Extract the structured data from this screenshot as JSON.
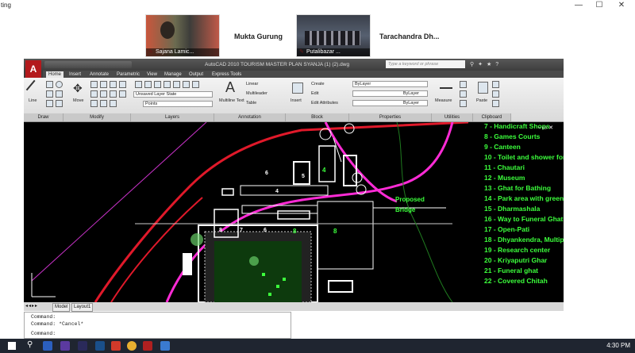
{
  "window": {
    "title": "ting",
    "buttons": [
      "—",
      "☐",
      "✕"
    ]
  },
  "participants": [
    {
      "caption": "Sajana Lamic...",
      "name": ""
    },
    {
      "caption": "",
      "name": "Mukta Gurung"
    },
    {
      "caption": "Putalibazar ...",
      "name": ""
    },
    {
      "caption": "",
      "name": "Tarachandra  Dh..."
    }
  ],
  "acad": {
    "title": "AutoCAD 2010    TOURISM MASTER PLAN SYANJA (1) (2).dwg",
    "search_placeholder": "Type a keyword or phrase",
    "tabs": [
      "Home",
      "Insert",
      "Annotate",
      "Parametric",
      "View",
      "Manage",
      "Output",
      "Express Tools"
    ],
    "panels": [
      "Draw",
      "Modify",
      "Layers",
      "Annotation",
      "Block",
      "Properties",
      "Utilities",
      "Clipboard"
    ],
    "ribbon": {
      "line": "Line",
      "move": "Move",
      "layer_state": "Unsaved Layer State",
      "points": "Points",
      "multiline_text": "Multiline Text",
      "linear": "Linear",
      "multileader": "Multileader",
      "table": "Table",
      "insert": "Insert",
      "create": "Create",
      "edit": "Edit",
      "edit_attributes": "Edit Attributes",
      "bylayer": "ByLayer",
      "measure": "Measure",
      "paste": "Paste"
    },
    "layout_tabs": [
      "Model",
      "Layout1"
    ]
  },
  "drawing": {
    "legend": [
      "7 - Handicraft Shops",
      "8 - Games Courts",
      "9 - Canteen",
      "10 - Toilet and shower for M",
      "11 - Chautari",
      "12 - Museum",
      "13 - Ghat for Bathing",
      "14 - Park area with greener",
      "15 - Dharmashala",
      "16 - Way to Funeral Ghat",
      "17 - Open-Pati",
      "18 - Dhyankendra, Multipur",
      "19 - Research center",
      "20 - Kriyaputri Ghar",
      "21 - Funeral ghat",
      "22 - Covered Chitah"
    ],
    "proposed": "Proposed",
    "bridge": "Bridge",
    "numbers": [
      "6",
      "4",
      "4",
      "5",
      "6",
      "8",
      "8",
      "8",
      "7"
    ]
  },
  "command": {
    "lines": [
      "Command:",
      "Command: *Cancel*",
      "Command:"
    ]
  },
  "taskbar": {
    "clock": "4:30 PM"
  }
}
